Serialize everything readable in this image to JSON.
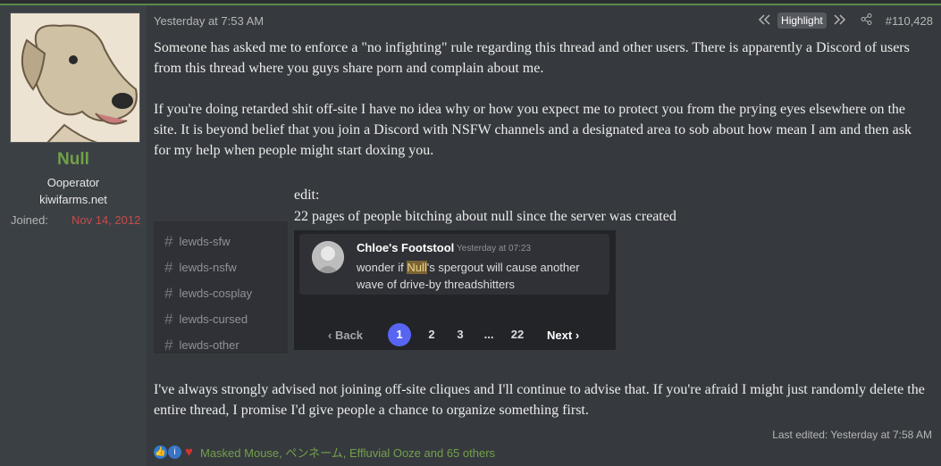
{
  "user": {
    "name": "Null",
    "title": "Ooperator",
    "domain": "kiwifarms.net",
    "joined_label": "Joined:",
    "joined_value": "Nov 14, 2012"
  },
  "post": {
    "timestamp": "Yesterday at 7:53 AM",
    "highlight_label": "Highlight",
    "number": "#110,428",
    "para1": "Someone has asked me to enforce a \"no infighting\" rule regarding this thread and other users. There is apparently a Discord of users from this thread where you guys share porn and complain about me.",
    "para2": "If you're doing retarded shit off-site I have no idea why or how you expect me to protect you from the prying eyes elsewhere on the site. It is beyond belief that you join a Discord with NSFW channels and a designated area to sob about how mean I am and then ask for my help when people might start doxing you.",
    "edit_label": "edit:",
    "edit_text": "22 pages of people bitching about null since the server was created",
    "para3": "I've always strongly advised not joining off-site cliques and I'll continue to advise that. If you're afraid I might just randomly delete the entire thread, I promise I'd give people a chance to organize something first.",
    "last_edited": "Last edited: Yesterday at 7:58 AM",
    "reactors": "Masked Mouse, ペンネーム, Effluvial Ooze and 65 others"
  },
  "channels": [
    "lewds-sfw",
    "lewds-nsfw",
    "lewds-cosplay",
    "lewds-cursed",
    "lewds-other"
  ],
  "discord": {
    "author": "Chloe's Footstool",
    "time": "Yesterday at 07:23",
    "msg_before": "wonder if ",
    "msg_highlight": "Null",
    "msg_after": "'s spergout will cause another wave of drive-by threadshitters",
    "pager": {
      "back": "Back",
      "pages": [
        "1",
        "2",
        "3",
        "...",
        "22"
      ],
      "current": "1",
      "next": "Next"
    }
  },
  "icons": {
    "first": "double-left-icon",
    "next": "double-right-icon",
    "share": "share-icon"
  },
  "colors": {
    "username": "#72a04a",
    "joined": "#c84a4a",
    "discord_accent": "#5865f2"
  }
}
